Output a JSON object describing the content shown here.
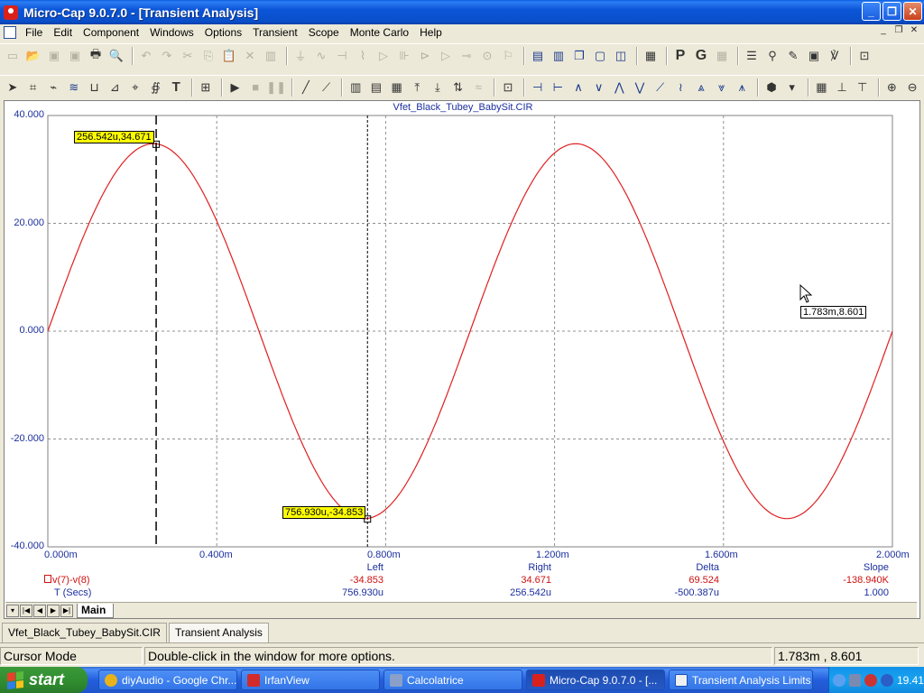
{
  "window": {
    "title": "Micro-Cap 9.0.7.0 - [Transient Analysis]"
  },
  "menu": [
    "File",
    "Edit",
    "Component",
    "Windows",
    "Options",
    "Transient",
    "Scope",
    "Monte Carlo",
    "Help"
  ],
  "plot": {
    "file_title": "Vfet_Black_Tubey_BabySit.CIR",
    "y_ticks": [
      "40.000",
      "20.000",
      "0.000",
      "-20.000",
      "-40.000"
    ],
    "x_ticks": [
      "0.000m",
      "0.400m",
      "0.800m",
      "1.200m",
      "1.600m",
      "2.000m"
    ],
    "cursor_left_tag": "256.542u,34.671",
    "cursor_right_tag": "756.930u,-34.853",
    "mouse_tag": "1.783m,8.601"
  },
  "chart_data": {
    "type": "line",
    "series": [
      {
        "name": "v(7)-v(8)",
        "color": "#e02020"
      }
    ],
    "x_unit": "Secs",
    "xlim": [
      0,
      0.002
    ],
    "ylim": [
      -40,
      40
    ],
    "amplitude": 34.76,
    "frequency_hz": 1000,
    "grid": true
  },
  "measurements": {
    "headers": {
      "left": "Left",
      "right": "Right",
      "delta": "Delta",
      "slope": "Slope"
    },
    "row_y": {
      "label": "v(7)-v(8)",
      "left": "-34.853",
      "right": "34.671",
      "delta": "69.524",
      "slope": "-138.940K"
    },
    "row_x": {
      "label": "T (Secs)",
      "left": "756.930u",
      "right": "256.542u",
      "delta": "-500.387u",
      "slope": "1.000"
    }
  },
  "sheet_tab": "Main",
  "window_tabs": [
    "Vfet_Black_Tubey_BabySit.CIR",
    "Transient Analysis"
  ],
  "status": {
    "mode": "Cursor Mode",
    "hint": "Double-click in the window for more options.",
    "coords": "1.783m , 8.601"
  },
  "taskbar": {
    "start": "start",
    "tasks": [
      {
        "label": "diyAudio - Google Chr...",
        "color": "#e8b21a"
      },
      {
        "label": "IrfanView",
        "color": "#d22b2b"
      },
      {
        "label": "Calcolatrice",
        "color": "#8aa0c8"
      },
      {
        "label": "Micro-Cap 9.0.7.0 - [...",
        "color": "#d9211c"
      },
      {
        "label": "Transient Analysis Limits",
        "color": "#f0f0f0"
      }
    ],
    "clock": "19.41"
  }
}
